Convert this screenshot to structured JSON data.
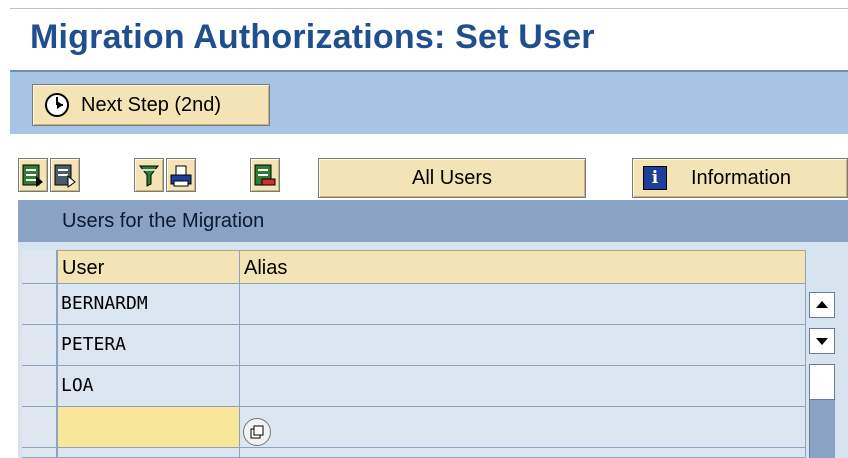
{
  "page": {
    "title": "Migration Authorizations: Set User"
  },
  "appbar": {
    "next_step_label": "Next Step (2nd)",
    "next_step_icon": "clock-execute-icon"
  },
  "toolbar": {
    "icons": [
      "select-all-icon",
      "deselect-all-icon",
      "filter-icon",
      "print-icon",
      "delete-row-icon"
    ],
    "all_users_label": "All Users",
    "information_label": "Information",
    "information_icon": "info-icon"
  },
  "table": {
    "title": "Users for the Migration",
    "columns": [
      "User",
      "Alias"
    ],
    "rows": [
      {
        "user": "BERNARDM",
        "alias": ""
      },
      {
        "user": "PETERA",
        "alias": ""
      },
      {
        "user": "LOA",
        "alias": ""
      },
      {
        "user": "",
        "alias": ""
      },
      {
        "user": "",
        "alias": ""
      }
    ]
  },
  "colors": {
    "title": "#1f4f8f",
    "appbar": "#a8c4e4",
    "button": "#f4e3b4",
    "input_highlight": "#f8e69a",
    "grid_body": "#dce6f1"
  }
}
